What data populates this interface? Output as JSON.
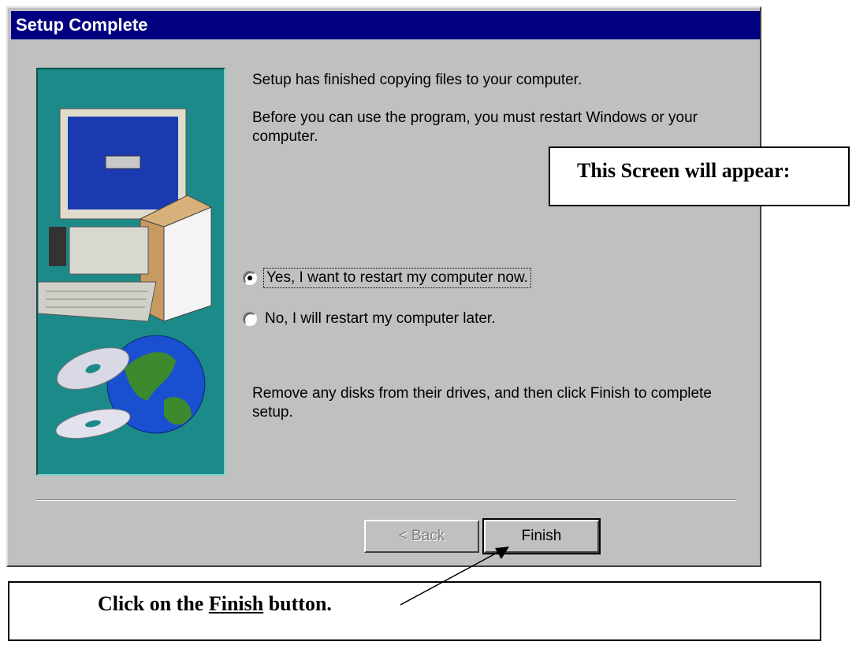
{
  "dialog": {
    "title": "Setup Complete",
    "message1": "Setup has finished copying files to your computer.",
    "message2": "Before you can use the program, you must restart Windows or your computer.",
    "options": [
      {
        "label": "Yes, I want to restart my computer now.",
        "checked": true
      },
      {
        "label": "No, I will restart my computer later.",
        "checked": false
      }
    ],
    "message3": "Remove any disks from their drives, and then click Finish to complete setup.",
    "buttons": {
      "back_label": "< Back",
      "finish_label": "Finish"
    }
  },
  "annotations": {
    "top_callout": "This Screen will appear:",
    "bottom_callout_prefix": "Click on the ",
    "bottom_callout_emph": "Finish",
    "bottom_callout_suffix": " button."
  },
  "colors": {
    "titlebar": "#000080",
    "dialog_bg": "#c0c0c0",
    "art_bg": "#1d8a8a"
  },
  "icons": {
    "art": "computer-globe-cd-illustration",
    "arrow": "pointer-arrow"
  }
}
